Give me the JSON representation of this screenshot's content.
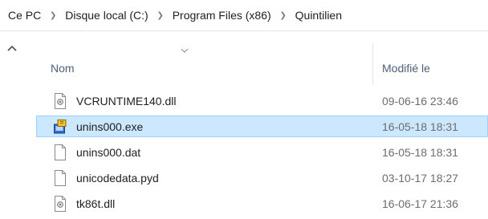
{
  "breadcrumb": {
    "items": [
      "Ce PC",
      "Disque local (C:)",
      "Program Files (x86)",
      "Quintilien"
    ]
  },
  "columns": {
    "name": "Nom",
    "modified": "Modifié le"
  },
  "files": [
    {
      "name": "VCRUNTIME140.dll",
      "modified": "09-06-16 23:46",
      "icon": "dll-file-icon",
      "selected": false
    },
    {
      "name": "unins000.exe",
      "modified": "16-05-18 18:31",
      "icon": "installer-exe-icon",
      "selected": true
    },
    {
      "name": "unins000.dat",
      "modified": "16-05-18 18:31",
      "icon": "blank-file-icon",
      "selected": false
    },
    {
      "name": "unicodedata.pyd",
      "modified": "03-10-17 18:27",
      "icon": "blank-file-icon",
      "selected": false
    },
    {
      "name": "tk86t.dll",
      "modified": "16-06-17 21:36",
      "icon": "dll-file-icon",
      "selected": false
    }
  ],
  "colors": {
    "selection_background": "#cce8ff",
    "selection_border": "#99d1ff",
    "header_text": "#4c607a",
    "date_text": "#6d6d6d"
  }
}
